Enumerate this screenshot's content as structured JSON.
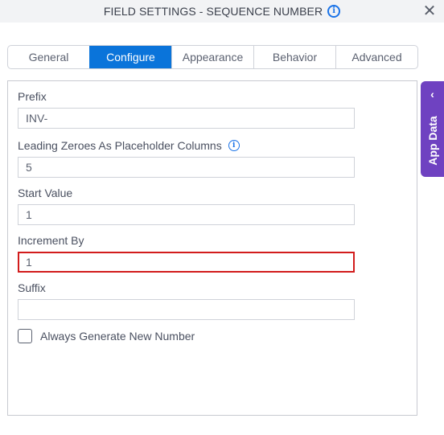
{
  "dialog": {
    "title": "FIELD SETTINGS - SEQUENCE NUMBER",
    "info_icon": "i",
    "close_icon": "✕"
  },
  "tabs": [
    {
      "label": "General",
      "active": false
    },
    {
      "label": "Configure",
      "active": true
    },
    {
      "label": "Appearance",
      "active": false
    },
    {
      "label": "Behavior",
      "active": false
    },
    {
      "label": "Advanced",
      "active": false
    }
  ],
  "form": {
    "prefix": {
      "label": "Prefix",
      "value": "INV-"
    },
    "leading_zeroes": {
      "label": "Leading Zeroes As Placeholder Columns",
      "value": "5",
      "info_icon": "i"
    },
    "start_value": {
      "label": "Start Value",
      "value": "1"
    },
    "increment_by": {
      "label": "Increment By",
      "value": "1",
      "state": "error"
    },
    "suffix": {
      "label": "Suffix",
      "value": ""
    },
    "always_generate": {
      "label": "Always Generate New Number",
      "checked": false
    }
  },
  "app_data": {
    "label": "App Data",
    "chevron_icon": "‹"
  },
  "colors": {
    "accent": "#0a74da",
    "info": "#1a73e8",
    "error": "#d21c1c",
    "app_data_bg": "#6f42c1"
  }
}
